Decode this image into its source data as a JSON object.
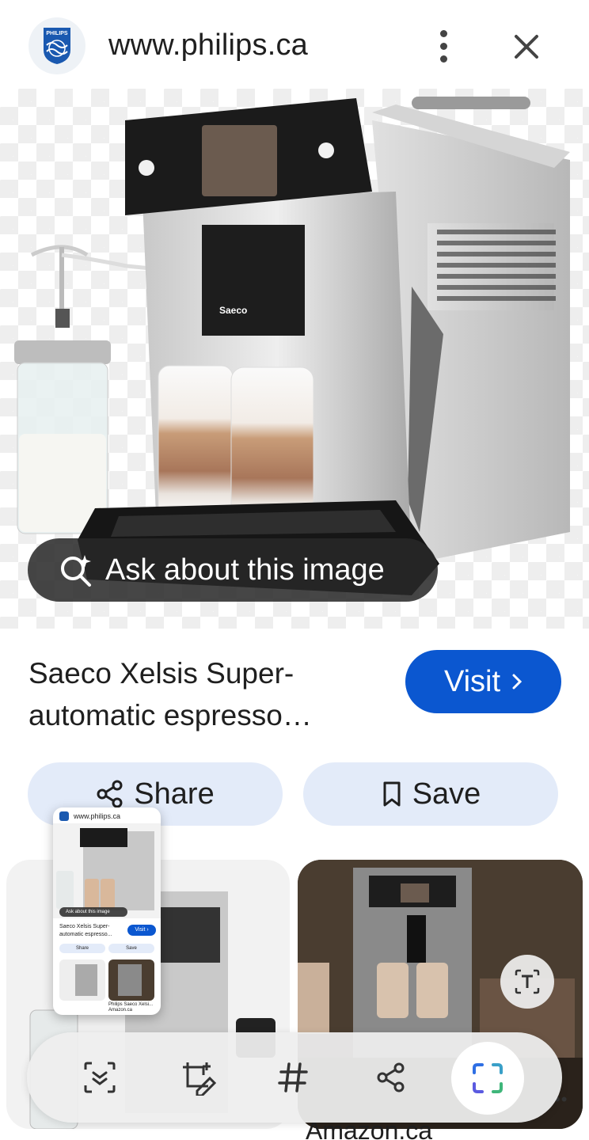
{
  "header": {
    "site_url": "www.philips.ca",
    "logo_text": "PHILIPS",
    "menu_icon": "more-vert-icon",
    "close_icon": "close-icon"
  },
  "hero": {
    "ask_label": "Ask about this image",
    "ask_icon": "ask-lens-icon"
  },
  "product": {
    "title": "Saeco Xelsis Super-automatic espresso…",
    "visit_label": "Visit",
    "visit_icon": "chevron-right-icon",
    "share_label": "Share",
    "save_label": "Save"
  },
  "related": {
    "right_source": "Amazon.ca"
  },
  "thumbnail": {
    "url": "www.philips.ca",
    "ask_label": "Ask about this image",
    "title": "Saeco Xelsis Super-automatic espresso...",
    "visit_label": "Visit ›",
    "share_label": "Share",
    "save_label": "Save",
    "caption": "Philips Saeco Xelsi... Amazon.ca"
  },
  "toolbar": {
    "tools": [
      "select-icon",
      "edit-crop-icon",
      "hashtag-icon",
      "share-icon",
      "screen-capture-icon"
    ]
  },
  "colors": {
    "accent": "#0b57d0",
    "pill_bg": "#e3ebf9",
    "dark_pill": "#282828"
  }
}
